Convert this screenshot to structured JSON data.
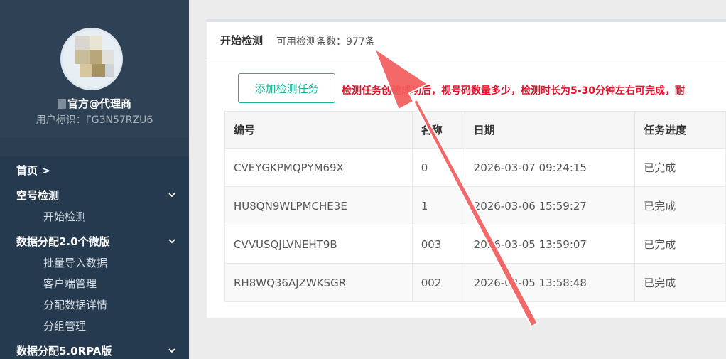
{
  "sidebar": {
    "username": "官方@代理商",
    "user_id": "用户标识：FG3N57RZU6",
    "home": "首页 >",
    "groups": [
      {
        "label": "空号检测",
        "items": [
          "开始检测"
        ]
      },
      {
        "label": "数据分配2.0个微版",
        "items": [
          "批量导入数据",
          "客户端管理",
          "分配数据详情",
          "分组管理"
        ]
      },
      {
        "label": "数据分配5.0RPA版",
        "items": []
      }
    ],
    "icons": {
      "avatar": "avatar-image",
      "chevron": "chevron-down-icon"
    }
  },
  "panel": {
    "title": "开始检测",
    "sub": "可用检测条数：977条",
    "add_button": "添加检测任务",
    "notice": "检测任务创建成功后，视号码数量多少，检测时长为5-30分钟左右可完成，耐"
  },
  "table": {
    "headers": [
      "编号",
      "名称",
      "日期",
      "任务进度"
    ],
    "rows": [
      [
        "CVEYGKPMQPYM69X",
        "0",
        "2026-03-07 09:24:15",
        "已完成"
      ],
      [
        "HU8QN9WLPMCHE3E",
        "1",
        "2026-03-06 15:59:27",
        "已完成"
      ],
      [
        "CVVUSQJLVNEHT9B",
        "003",
        "2026-03-05 13:59:07",
        "已完成"
      ],
      [
        "RH8WQ36AJZWKSGR",
        "002",
        "2026-03-05 13:58:48",
        "已完成"
      ]
    ]
  },
  "colors": {
    "accent": "#1ab394",
    "notice": "#e8102b",
    "arrow": "#f25c5c",
    "sidebar": "#263a4f"
  }
}
